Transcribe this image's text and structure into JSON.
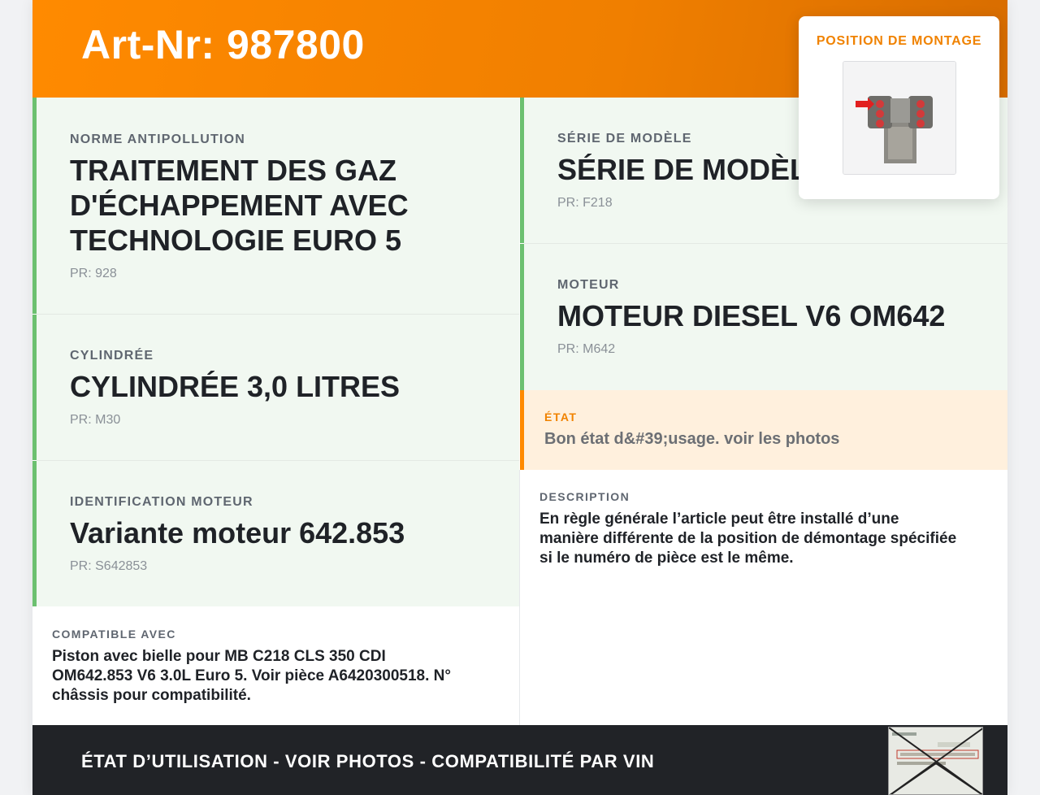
{
  "header": {
    "art_nr": "Art-Nr: 987800"
  },
  "left_cards": [
    {
      "label": "NORME ANTIPOLLUTION",
      "value": "TRAITEMENT DES GAZ D'ÉCHAPPEMENT AVEC TECHNOLOGIE EURO 5",
      "pr": "PR: 928"
    },
    {
      "label": "CYLINDRÉE",
      "value": "CYLINDRÉE 3,0 LITRES",
      "pr": "PR: M30"
    },
    {
      "label": "IDENTIFICATION MOTEUR",
      "value": "Variante moteur 642.853",
      "pr": "PR: S642853"
    }
  ],
  "right_cards": [
    {
      "label": "SÉRIE DE MODÈLE",
      "value": "SÉRIE DE MODÈL",
      "pr": "PR: F218"
    },
    {
      "label": "MOTEUR",
      "value": "MOTEUR DIESEL V6 OM642",
      "pr": "PR: M642"
    }
  ],
  "etat": {
    "label": "ÉTAT",
    "value": "Bon état d&#39;usage. voir les photos"
  },
  "compatible": {
    "label": "COMPATIBLE AVEC",
    "lines": [
      "Piston avec bielle pour MB C218 CLS 350 CDI",
      "OM642.853 V6 3.0L Euro 5. Voir pièce A6420300518. N°",
      "châssis pour compatibilité."
    ]
  },
  "description": {
    "label": "DESCRIPTION",
    "lines": [
      "En règle générale l’article peut être installé d’une",
      "manière différente de la position de démontage spécifiée",
      "si le numéro de pièce est le même."
    ]
  },
  "mount_position": {
    "title": "POSITION DE MONTAGE"
  },
  "footer": {
    "text": "ÉTAT D’UTILISATION - VOIR PHOTOS - COMPATIBILITÉ PAR VIN"
  },
  "colors": {
    "accent": "#ff8a00",
    "card_border": "#6cc070",
    "card_bg": "#f1f8f1",
    "etat_bg": "#fff0dd",
    "footer_bg": "#212327"
  },
  "icons": {
    "mount_image": "engine-diagram-icon",
    "vin_thumbnail": "vin-document-icon"
  }
}
